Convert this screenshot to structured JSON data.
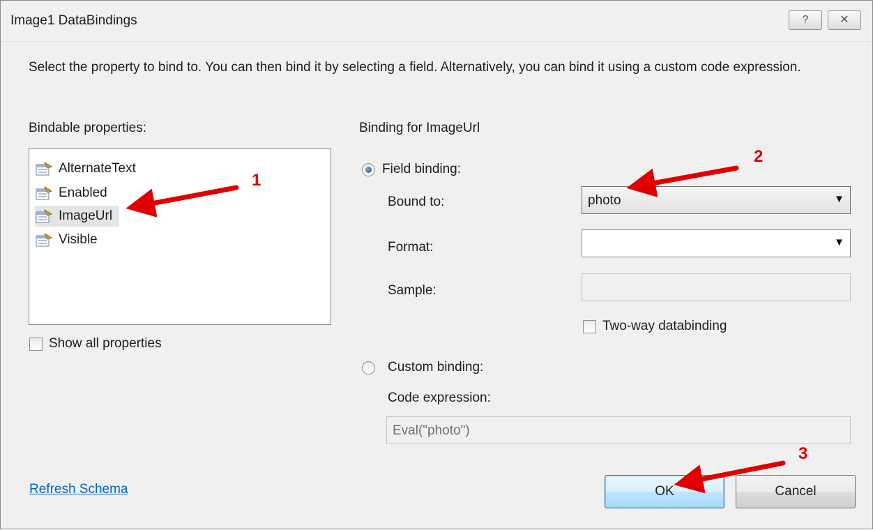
{
  "dialog": {
    "title": "Image1 DataBindings",
    "help_glyph": "?",
    "close_glyph": "✕",
    "instruction": "Select the property to bind to. You can then bind it by selecting a field. Alternatively, you can bind it using a custom code expression."
  },
  "left": {
    "heading": "Bindable properties:",
    "items": [
      {
        "label": "AlternateText",
        "icon": "property-icon"
      },
      {
        "label": "Enabled",
        "icon": "property-icon"
      },
      {
        "label": "ImageUrl",
        "icon": "property-icon",
        "selected": true
      },
      {
        "label": "Visible",
        "icon": "property-icon"
      }
    ],
    "show_all_label": "Show all properties",
    "show_all_checked": false,
    "refresh_link": "Refresh Schema"
  },
  "right": {
    "heading": "Binding for ImageUrl",
    "field_binding_label": "Field binding:",
    "field_binding_selected": true,
    "bound_to_label": "Bound to:",
    "bound_to_value": "photo",
    "format_label": "Format:",
    "format_value": "",
    "sample_label": "Sample:",
    "sample_value": "",
    "two_way_label": "Two-way databinding",
    "two_way_checked": false,
    "custom_binding_label": "Custom binding:",
    "custom_binding_selected": false,
    "code_expression_label": "Code expression:",
    "code_expression_value": "Eval(\"photo\")"
  },
  "buttons": {
    "ok": "OK",
    "cancel": "Cancel"
  },
  "annotations": {
    "marker_1": "1",
    "marker_2": "2",
    "marker_3": "3",
    "color": "#e00000"
  },
  "colors": {
    "dialog_bg": "#f0f0f0",
    "link": "#0066cc",
    "selected_item_bg": "#e4e4e4"
  }
}
